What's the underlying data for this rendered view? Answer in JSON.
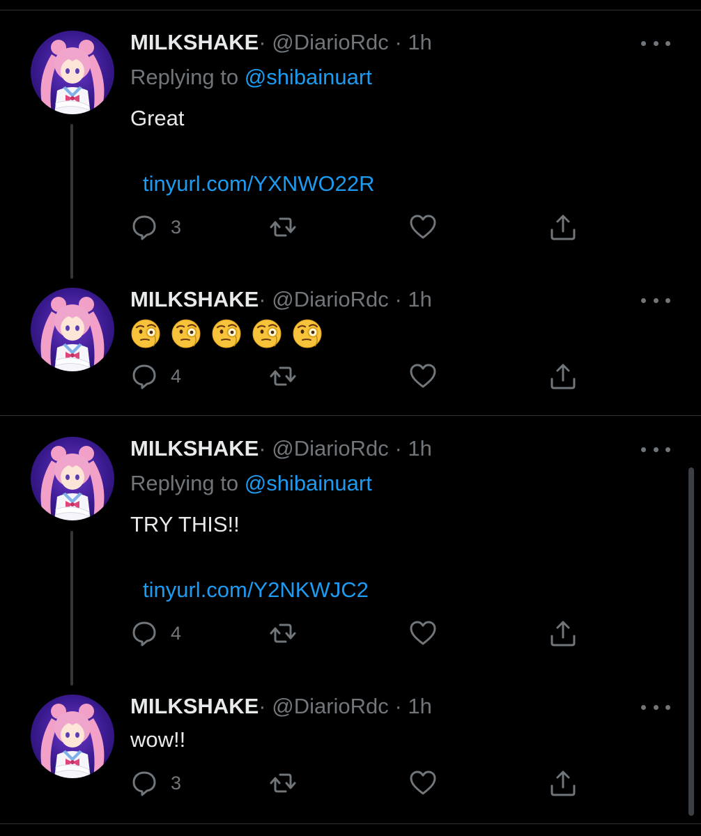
{
  "tweets": [
    {
      "name": "MILKSHAKE",
      "separator": "·",
      "handle": "@DiarioRdc",
      "time": "· 1h",
      "replying_prefix": "Replying to ",
      "replying_handle": "@shibainuart",
      "text": "Great",
      "link": "tinyurl.com/YXNWO22R",
      "reply_count": "3"
    },
    {
      "name": "MILKSHAKE",
      "separator": "·",
      "handle": "@DiarioRdc",
      "time": "· 1h",
      "emoji_name": "face-with-monocle",
      "emoji_count": 5,
      "reply_count": "4"
    },
    {
      "name": "MILKSHAKE",
      "separator": "·",
      "handle": "@DiarioRdc",
      "time": "· 1h",
      "replying_prefix": "Replying to ",
      "replying_handle": "@shibainuart",
      "text": "TRY THIS!!",
      "link": "tinyurl.com/Y2NKWJC2",
      "reply_count": "4"
    },
    {
      "name": "MILKSHAKE",
      "separator": "·",
      "handle": "@DiarioRdc",
      "time": "· 1h",
      "text": "wow!!",
      "reply_count": "3"
    }
  ],
  "icons": {
    "reply": "speech-bubble-icon",
    "retweet": "retweet-icon",
    "like": "heart-icon",
    "share": "share-icon",
    "more": "more-dots-icon"
  },
  "colors": {
    "background": "#000000",
    "text": "#e7e9ea",
    "secondary": "#71767b",
    "link": "#1d9bf0",
    "avatar_bg": "#3a1a8f"
  }
}
